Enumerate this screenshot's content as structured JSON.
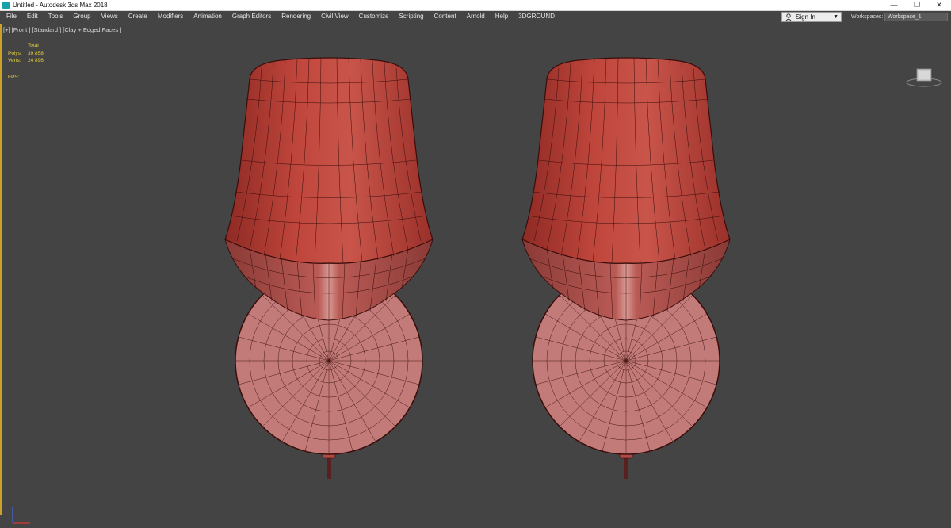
{
  "window": {
    "title": "Untitled - Autodesk 3ds Max 2018",
    "minimize": "—",
    "restore": "❐",
    "close": "✕"
  },
  "menu": [
    "File",
    "Edit",
    "Tools",
    "Group",
    "Views",
    "Create",
    "Modifiers",
    "Animation",
    "Graph Editors",
    "Rendering",
    "Civil View",
    "Customize",
    "Scripting",
    "Content",
    "Arnold",
    "Help",
    "3DGROUND"
  ],
  "account": {
    "sign_in": "Sign In",
    "arrow": "▼"
  },
  "workspaces": {
    "label": "Workspaces:",
    "value": "Workspace_1"
  },
  "viewport": {
    "label": "[+] [Front ] [Standard ] [Clay + Edged Faces ]",
    "stats": {
      "header": "Total",
      "polys_label": "Polys:",
      "polys_value": "39 858",
      "verts_label": "Verts:",
      "verts_value": "24 896",
      "fps_label": "FPS:"
    }
  },
  "colors": {
    "clay": "#b54a40",
    "clay_dark": "#7a2420",
    "disc": "#c27b78",
    "wire": "#3a0d0b",
    "viewport_bg": "#444444",
    "active_border": "#c9a227",
    "stats_text": "#e6d23a"
  },
  "icons": [
    "app-icon",
    "user-icon",
    "viewcube-icon",
    "axis-gizmo-icon"
  ]
}
